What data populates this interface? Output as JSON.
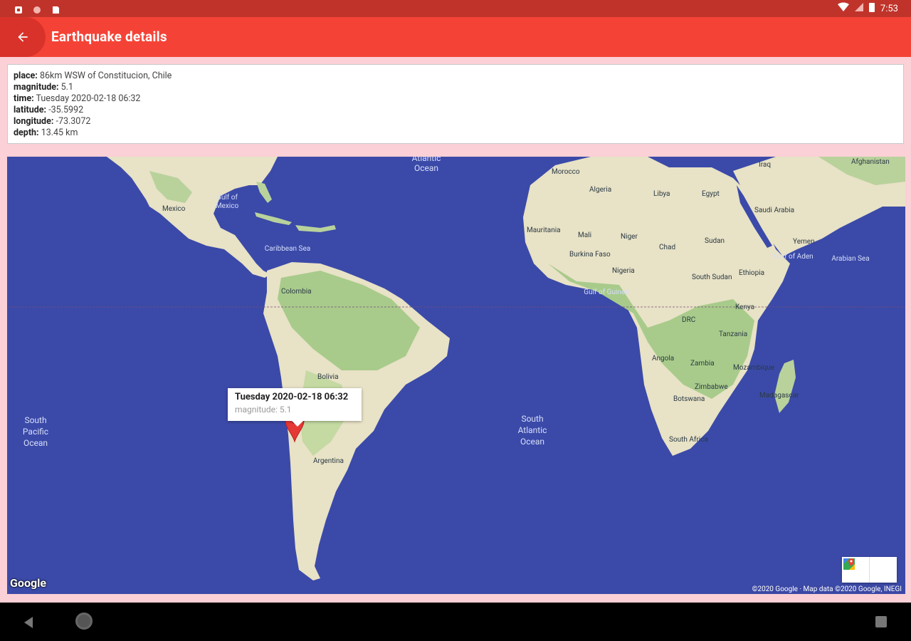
{
  "status_bar": {
    "time": "7:53"
  },
  "app_bar": {
    "title": "Earthquake details",
    "back_icon": "arrow-back-icon"
  },
  "details": {
    "place_label": "place:",
    "place": "86km WSW of Constitucion, Chile",
    "magnitude_label": "magnitude:",
    "magnitude": "5.1",
    "time_label": "time:",
    "time": "Tuesday 2020-02-18 06:32",
    "latitude_label": "latitude:",
    "latitude": "-35.5992",
    "longitude_label": "longitude:",
    "longitude": "-73.3072",
    "depth_label": "depth:",
    "depth": "13.45 km"
  },
  "map": {
    "info_window": {
      "title": "Tuesday 2020-02-18 06:32",
      "subtitle": "magnitude: 5.1"
    },
    "oceans": {
      "atlantic": [
        "Atlantic",
        "Ocean"
      ],
      "south_pacific": [
        "South",
        "Pacific",
        "Ocean"
      ],
      "south_atlantic": [
        "South",
        "Atlantic",
        "Ocean"
      ]
    },
    "labels": {
      "mexico": "Mexico",
      "gulf_of_mexico": [
        "Gulf of",
        "Mexico"
      ],
      "caribbean_sea": "Caribbean Sea",
      "colombia": "Colombia",
      "bolivia": "Bolivia",
      "argentina": "Argentina",
      "morocco": "Morocco",
      "algeria": "Algeria",
      "libya": "Libya",
      "egypt": "Egypt",
      "iraq": "Iraq",
      "afghanistan": "Afghanistan",
      "saudi_arabia": "Saudi Arabia",
      "yemen": "Yemen",
      "gulf_of_aden": "Gulf of Aden",
      "arabian_sea": "Arabian Sea",
      "mauritania": "Mauritania",
      "mali": "Mali",
      "niger": "Niger",
      "chad": "Chad",
      "sudan": "Sudan",
      "south_sudan": "South Sudan",
      "ethiopia": "Ethiopia",
      "nigeria": "Nigeria",
      "gulf_of_guinea": "Gulf of Guinea",
      "burkina_faso": "Burkina Faso",
      "drc": "DRC",
      "kenya": "Kenya",
      "tanzania": "Tanzania",
      "angola": "Angola",
      "zambia": "Zambia",
      "zimbabwe": "Zimbabwe",
      "mozambique": "Mozambique",
      "madagascar": "Madagascar",
      "botswana": "Botswana",
      "south_africa": "South Africa"
    },
    "google_logo": "Google",
    "copyright": "©2020 Google · Map data ©2020 Google, INEGI",
    "directions_icon": "directions-icon",
    "open_maps_icon": "google-maps-icon",
    "marker_icon": "map-marker-icon"
  }
}
